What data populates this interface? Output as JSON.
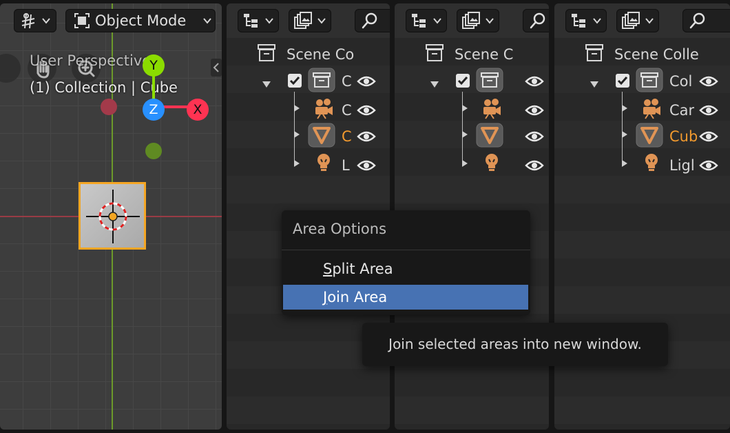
{
  "viewport": {
    "mode": "Object Mode",
    "view_name": "User Perspective",
    "object_info": "(1) Collection | Cube",
    "axes": {
      "y": "Y",
      "z": "Z",
      "x": "X"
    }
  },
  "outliners": [
    {
      "title": "Scene Co",
      "rows": [
        {
          "label": "C",
          "icon": "collection-icon"
        },
        {
          "label": "C",
          "icon": "camera-icon"
        },
        {
          "label": "C",
          "icon": "mesh-icon",
          "active": true
        },
        {
          "label": "L",
          "icon": "light-icon"
        }
      ]
    },
    {
      "title": "Scene C",
      "rows": [
        {
          "label": "",
          "icon": "collection-icon"
        },
        {
          "label": "",
          "icon": "camera-icon"
        },
        {
          "label": "",
          "icon": "mesh-icon",
          "active": true
        },
        {
          "label": "",
          "icon": "light-icon"
        }
      ]
    },
    {
      "title": "Scene Colle",
      "rows": [
        {
          "label": "Col",
          "icon": "collection-icon"
        },
        {
          "label": "Car",
          "icon": "camera-icon"
        },
        {
          "label": "Cub",
          "icon": "mesh-icon",
          "active": true
        },
        {
          "label": "Ligl",
          "icon": "light-icon"
        }
      ]
    }
  ],
  "menu": {
    "title": "Area Options",
    "items": [
      {
        "first": "S",
        "rest": "plit Area"
      },
      {
        "first": "J",
        "rest": "oin Area"
      }
    ]
  },
  "tooltip": "Join selected areas into new window.",
  "colors": {
    "active_object": "#f29a2e",
    "highlight": "#4772b3",
    "axis_x": "#ff3352",
    "axis_y": "#8bdc00",
    "axis_z": "#2890ff"
  }
}
